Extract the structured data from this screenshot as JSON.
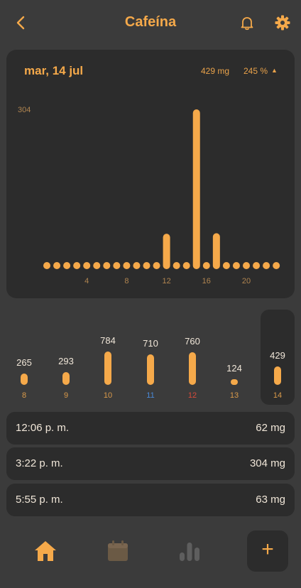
{
  "header": {
    "title": "Cafeína"
  },
  "card": {
    "date": "mar, 14 jul",
    "total": "429 mg",
    "percent": "245 %",
    "percent_arrow": "▲"
  },
  "chart_data": {
    "type": "bar",
    "x": [
      0,
      1,
      2,
      3,
      4,
      5,
      6,
      7,
      8,
      9,
      10,
      11,
      12,
      13,
      14,
      15,
      16,
      17,
      18,
      19,
      20,
      21,
      22,
      23
    ],
    "values": [
      0,
      0,
      0,
      0,
      0,
      0,
      0,
      0,
      0,
      0,
      0,
      0,
      62,
      0,
      0,
      304,
      0,
      63,
      0,
      0,
      0,
      0,
      0,
      0
    ],
    "max_label": "304",
    "x_ticks": [
      "4",
      "8",
      "12",
      "16",
      "20"
    ],
    "x_tick_values": [
      4,
      8,
      12,
      16,
      20
    ],
    "ylim": [
      0,
      304
    ],
    "color": "#f5a94a"
  },
  "days": [
    {
      "value": "265",
      "label": "8",
      "mg": 265,
      "label_color": "#d99a4a"
    },
    {
      "value": "293",
      "label": "9",
      "mg": 293,
      "label_color": "#d99a4a"
    },
    {
      "value": "784",
      "label": "10",
      "mg": 784,
      "label_color": "#d99a4a"
    },
    {
      "value": "710",
      "label": "11",
      "mg": 710,
      "label_color": "#4a8ad9"
    },
    {
      "value": "760",
      "label": "12",
      "mg": 760,
      "label_color": "#d94a3a"
    },
    {
      "value": "124",
      "label": "13",
      "mg": 124,
      "label_color": "#d99a4a"
    },
    {
      "value": "429",
      "label": "14",
      "mg": 429,
      "label_color": "#d99a4a"
    }
  ],
  "entries": [
    {
      "time": "12:06 p. m.",
      "amount": "62 mg"
    },
    {
      "time": "3:22 p. m.",
      "amount": "304 mg"
    },
    {
      "time": "5:55 p. m.",
      "amount": "63 mg"
    }
  ],
  "nav": {
    "home_icon": "home-icon",
    "calendar_icon": "calendar-icon",
    "stats_icon": "bar-chart-icon",
    "add_label": "+"
  },
  "colors": {
    "accent": "#f5a94a",
    "background": "#3b3b3b",
    "card": "#2c2c2c"
  }
}
